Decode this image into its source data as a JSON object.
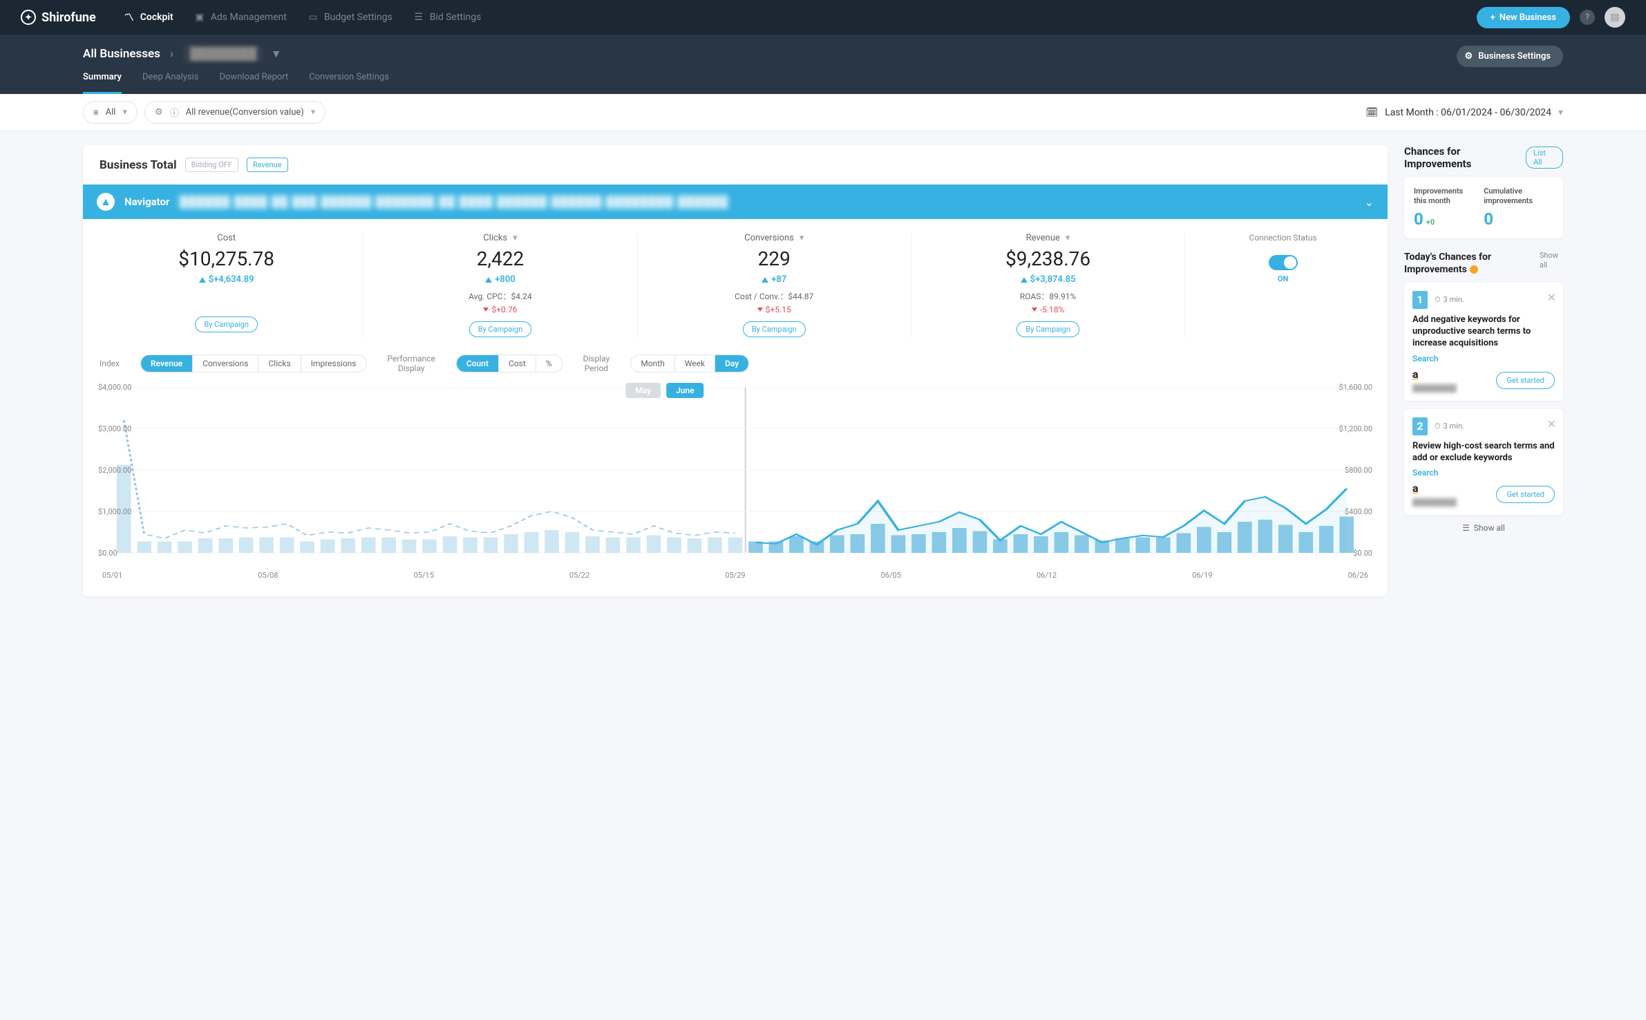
{
  "brand": "Shirofune",
  "nav": {
    "cockpit": "Cockpit",
    "ads": "Ads Management",
    "budget": "Budget Settings",
    "bid": "Bid Settings",
    "new_business": "New Business"
  },
  "breadcrumb": {
    "all": "All Businesses",
    "biz": "████████"
  },
  "subtabs": {
    "summary": "Summary",
    "deep": "Deep Analysis",
    "download": "Download Report",
    "conv": "Conversion Settings"
  },
  "biz_settings": "Business Settings",
  "filters": {
    "all": "All",
    "revenue": "All revenue(Conversion value)",
    "date": "Last Month : 06/01/2024 - 06/30/2024"
  },
  "card": {
    "title": "Business Total",
    "tag1": "Bidding OFF",
    "tag2": "Revenue"
  },
  "navigator": {
    "label": "Navigator",
    "text": "██████ ████ ██ ███ ██████  ███████ ██ ████  ██████ ██████ ████████  ██████"
  },
  "metrics": {
    "cost": {
      "label": "Cost",
      "value": "$10,275.78",
      "delta": "$+4,634.89",
      "by": "By Campaign"
    },
    "clicks": {
      "label": "Clicks",
      "value": "2,422",
      "delta": "+800",
      "sub": "Avg. CPC：$4.24",
      "sub2": "$+0.76",
      "by": "By Campaign"
    },
    "conv": {
      "label": "Conversions",
      "value": "229",
      "delta": "+87",
      "sub": "Cost / Conv.：$44.87",
      "sub2": "$+5.15",
      "by": "By Campaign"
    },
    "revenue": {
      "label": "Revenue",
      "value": "$9,238.76",
      "delta": "$+3,874.85",
      "sub": "ROAS：89.91%",
      "sub2": "-5.18%",
      "by": "By Campaign"
    },
    "conn": {
      "label": "Connection Status",
      "state": "ON"
    }
  },
  "seg": {
    "index_label": "Index",
    "index": [
      "Revenue",
      "Conversions",
      "Clicks",
      "Impressions"
    ],
    "perf_label": "Performance\nDisplay",
    "perf": [
      "Count",
      "Cost",
      "%"
    ],
    "period_label": "Display\nPeriod",
    "period": [
      "Month",
      "Week",
      "Day"
    ]
  },
  "months": {
    "may": "May",
    "june": "June"
  },
  "right": {
    "title": "Chances for Improvements",
    "list_all": "List All",
    "imp1_label": "Improvements\nthis month",
    "imp1_val": "0",
    "imp1_delta": "+0",
    "imp2_label": "Cumulative\nimprovements",
    "imp2_val": "0",
    "today_title": "Today's Chances for Improvements",
    "show_all": "Show all",
    "c1": {
      "num": "1",
      "time": "3 min.",
      "title": "Add negative keywords for unproductive search terms to increase acquisitions",
      "cat": "Search",
      "platform": "a",
      "btn": "Get started",
      "blur": "█████████"
    },
    "c2": {
      "num": "2",
      "time": "3 min.",
      "title": "Review high-cost search terms and add or exclude keywords",
      "cat": "Search",
      "platform": "a",
      "btn": "Get started",
      "blur": "█████████"
    },
    "show_all_bottom": "Show all"
  },
  "chart_data": {
    "type": "bar+line",
    "title": "",
    "xlabels": [
      "05/01",
      "05/08",
      "05/15",
      "05/22",
      "05/29",
      "06/05",
      "06/12",
      "06/19",
      "06/26"
    ],
    "left_axis": {
      "label": "",
      "ticks": [
        "$0.00",
        "$1,000.00",
        "$2,000.00",
        "$3,000.00",
        "$4,000.00"
      ],
      "range": [
        0,
        4000
      ]
    },
    "right_axis": {
      "label": "",
      "ticks": [
        "$0.00",
        "$400.00",
        "$800.00",
        "$1,200.00",
        "$1,600.00"
      ],
      "range": [
        0,
        1600
      ]
    },
    "series": [
      {
        "name": "May (line dashed)",
        "axis": "left",
        "style": "dashed",
        "color": "#9cc7db",
        "values": [
          3200,
          450,
          350,
          550,
          480,
          650,
          600,
          620,
          700,
          420,
          500,
          480,
          600,
          550,
          480,
          500,
          700,
          520,
          480,
          650,
          900,
          1000,
          850,
          550,
          500,
          450,
          650,
          480,
          420,
          500,
          480
        ]
      },
      {
        "name": "June (line)",
        "axis": "left",
        "style": "solid",
        "color": "#36b1e1",
        "values": [
          250,
          220,
          450,
          200,
          550,
          700,
          1250,
          550,
          650,
          750,
          980,
          800,
          300,
          650,
          450,
          750,
          500,
          250,
          350,
          420,
          380,
          650,
          1020,
          700,
          1250,
          1350,
          1080,
          700,
          1050,
          1550
        ]
      },
      {
        "name": "May (bars)",
        "axis": "right",
        "style": "bar",
        "color": "#cfe7f2",
        "values": [
          850,
          110,
          110,
          110,
          140,
          140,
          150,
          150,
          150,
          110,
          130,
          140,
          150,
          150,
          130,
          130,
          160,
          150,
          150,
          180,
          200,
          220,
          200,
          160,
          150,
          150,
          170,
          150,
          140,
          150,
          150
        ]
      },
      {
        "name": "June (bars)",
        "axis": "right",
        "style": "bar",
        "color": "#8fcbe6",
        "values": [
          110,
          110,
          160,
          110,
          170,
          180,
          280,
          170,
          180,
          200,
          240,
          210,
          130,
          180,
          160,
          200,
          170,
          120,
          140,
          150,
          150,
          190,
          250,
          200,
          300,
          320,
          270,
          200,
          260,
          350
        ]
      }
    ]
  }
}
